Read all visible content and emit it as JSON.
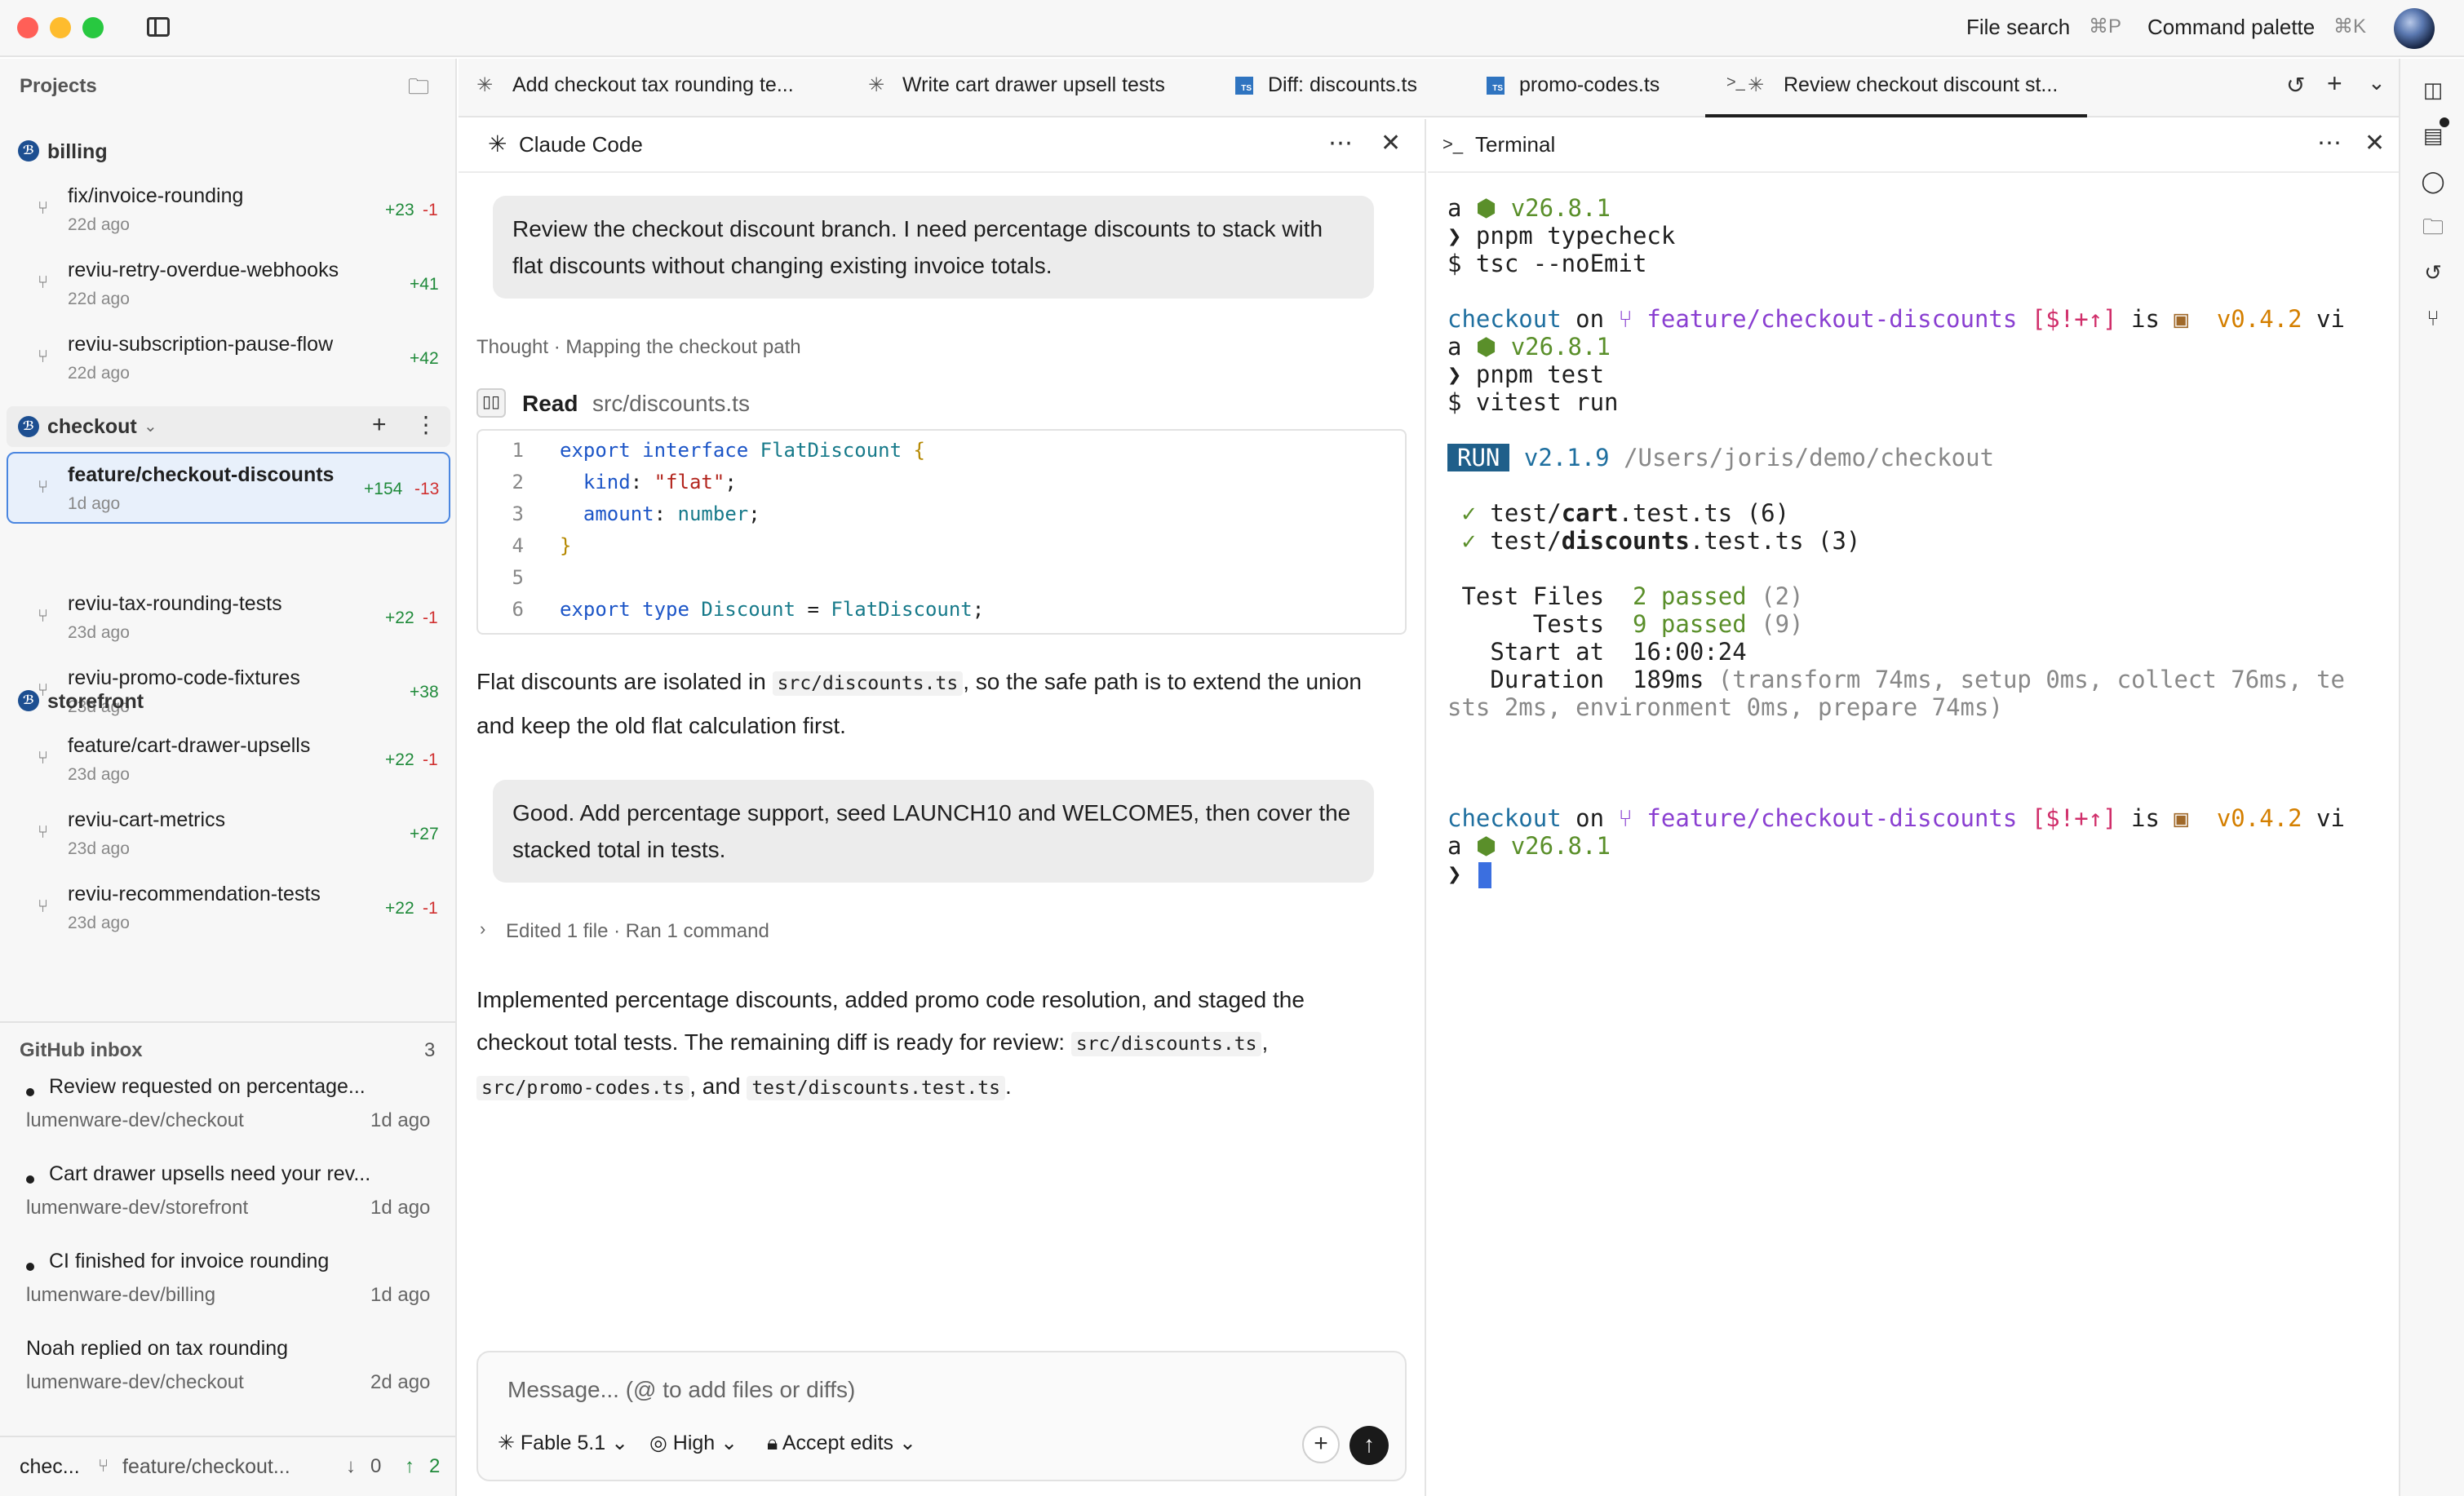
{
  "titlebar": {
    "file_search": "File search",
    "file_search_kbd": "⌘P",
    "command_palette": "Command palette",
    "command_palette_kbd": "⌘K"
  },
  "sidebar": {
    "projects_label": "Projects",
    "projects": [
      {
        "name": "billing",
        "branches": [
          {
            "name": "fix/invoice-rounding",
            "age": "22d ago",
            "add": "+23",
            "del": "-1"
          },
          {
            "name": "reviu-retry-overdue-webhooks",
            "age": "22d ago",
            "add": "+41",
            "del": ""
          },
          {
            "name": "reviu-subscription-pause-flow",
            "age": "22d ago",
            "add": "+42",
            "del": ""
          }
        ]
      },
      {
        "name": "checkout",
        "branches": [
          {
            "name": "feature/checkout-discounts",
            "age": "1d ago",
            "add": "+154",
            "del": "-13"
          },
          {
            "name": "reviu-tax-rounding-tests",
            "age": "23d ago",
            "add": "+22",
            "del": "-1"
          },
          {
            "name": "reviu-promo-code-fixtures",
            "age": "23d ago",
            "add": "+38",
            "del": ""
          }
        ]
      },
      {
        "name": "storefront",
        "branches": [
          {
            "name": "feature/cart-drawer-upsells",
            "age": "23d ago",
            "add": "+22",
            "del": "-1"
          },
          {
            "name": "reviu-cart-metrics",
            "age": "23d ago",
            "add": "+27",
            "del": ""
          },
          {
            "name": "reviu-recommendation-tests",
            "age": "23d ago",
            "add": "+22",
            "del": "-1"
          }
        ]
      }
    ],
    "inbox": {
      "title": "GitHub inbox",
      "count": "3",
      "items": [
        {
          "title": "Review requested on percentage...",
          "repo": "lumenware-dev/checkout",
          "age": "1d ago"
        },
        {
          "title": "Cart drawer upsells need your rev...",
          "repo": "lumenware-dev/storefront",
          "age": "1d ago"
        },
        {
          "title": "CI finished for invoice rounding",
          "repo": "lumenware-dev/billing",
          "age": "1d ago"
        },
        {
          "title": "Noah replied on tax rounding",
          "repo": "lumenware-dev/checkout",
          "age": "2d ago"
        }
      ]
    },
    "status": {
      "project": "chec...",
      "branch": "feature/checkout...",
      "behind": "0",
      "ahead": "2"
    }
  },
  "tabs": [
    {
      "label": "Add checkout tax rounding te..."
    },
    {
      "label": "Write cart drawer upsell tests"
    },
    {
      "label": "Diff: discounts.ts"
    },
    {
      "label": "promo-codes.ts"
    },
    {
      "label": "Review checkout discount st..."
    }
  ],
  "claude": {
    "title": "Claude Code",
    "msg1": "Review the checkout discount branch. I need percentage discounts to stack with flat discounts without changing existing invoice totals.",
    "thought": "Thought · Mapping the checkout path",
    "read_label": "Read",
    "read_path": "src/discounts.ts",
    "code_lines": [
      "1",
      "2",
      "3",
      "4",
      "5",
      "6"
    ],
    "reply1_a": "Flat discounts are isolated in ",
    "reply1_code": "src/discounts.ts",
    "reply1_b": ", so the safe path is to extend the union and keep the old flat calculation first.",
    "msg2": "Good. Add percentage support, seed LAUNCH10 and WELCOME5, then cover the stacked total in tests.",
    "summary": "Edited 1 file · Ran 1 command",
    "reply2_a": "Implemented percentage discounts, added promo code resolution, and staged the checkout total tests. The remaining diff is ready for review: ",
    "reply2_code1": "src/discounts.ts",
    "reply2_sep": ", ",
    "reply2_code2": "src/promo-codes.ts",
    "reply2_and": ", and ",
    "reply2_code3": "test/discounts.test.ts",
    "reply2_end": ".",
    "composer_placeholder": "Message... (@ to add files or diffs)",
    "model": "Fable 5.1",
    "effort": "High",
    "mode": "Accept edits"
  },
  "terminal": {
    "title": "Terminal",
    "node_version": "v26.8.1",
    "cmd1": "pnpm typecheck",
    "out1": "$ tsc --noEmit",
    "dir": "checkout",
    "branch": "feature/checkout-discounts",
    "git_status": "[$!+↑]",
    "pkg_version": "v0.4.2",
    "cmd2": "pnpm test",
    "out2": "$ vitest run",
    "run_badge": "RUN",
    "vitest_version": "v2.1.9",
    "run_path": "/Users/joris/demo/checkout",
    "test1_dir": "test/",
    "test1_name": "cart",
    "test1_rest": ".test.ts (6)",
    "test2_dir": "test/",
    "test2_name": "discounts",
    "test2_rest": ".test.ts (3)",
    "files_label": " Test Files",
    "files_passed": "2 passed",
    "files_total": "(2)",
    "tests_label": "      Tests",
    "tests_passed": "9 passed",
    "tests_total": "(9)",
    "start_label": "   Start at",
    "start_value": "16:00:24",
    "duration_label": "   Duration",
    "duration_value": "189ms",
    "duration_detail_a": "(transform 74ms, setup 0ms, collect 76ms, te",
    "duration_detail_b": "sts 2ms, environment 0ms, prepare 74ms)"
  }
}
